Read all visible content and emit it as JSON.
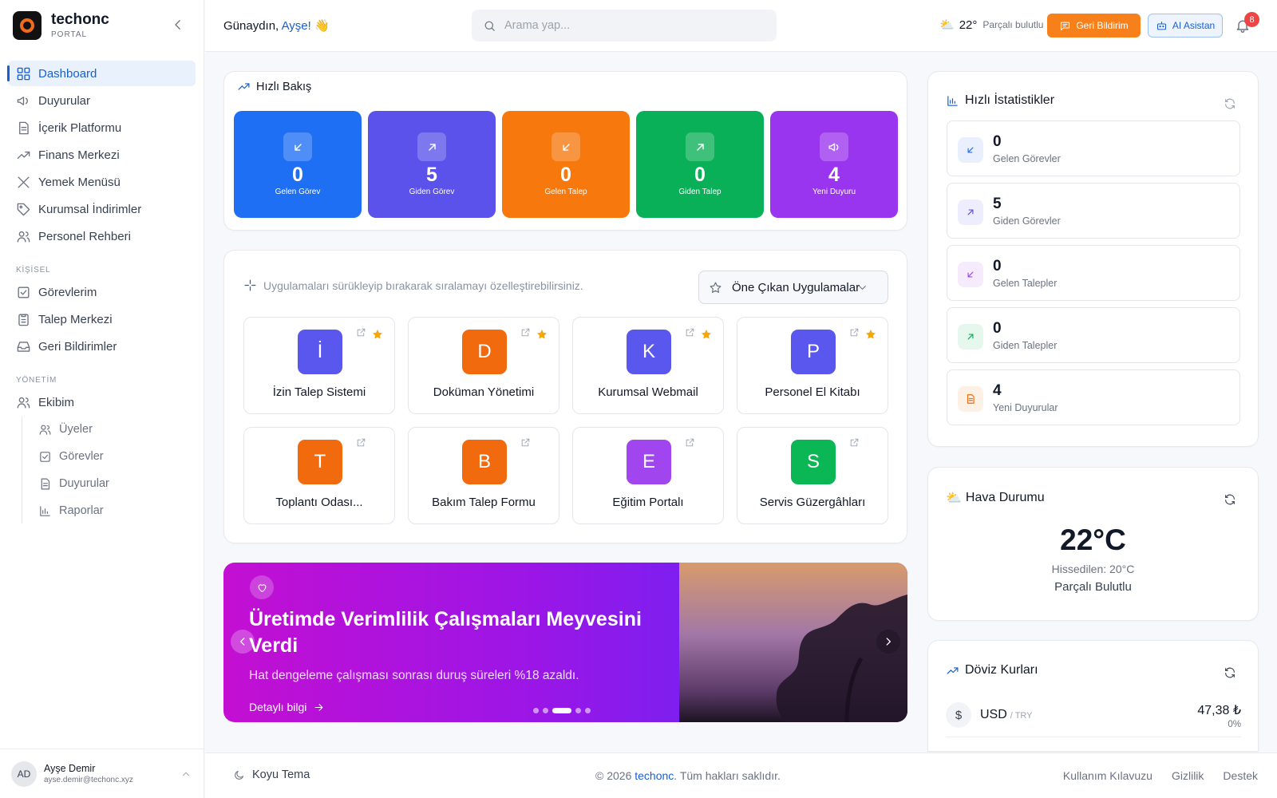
{
  "brand": {
    "name": "techonc",
    "sub": "PORTAL"
  },
  "sidebar": {
    "main": [
      {
        "label": "Dashboard",
        "icon": "grid-icon"
      },
      {
        "label": "Duyurular",
        "icon": "megaphone-icon"
      },
      {
        "label": "İçerik Platformu",
        "icon": "document-icon"
      },
      {
        "label": "Finans Merkezi",
        "icon": "trend-icon"
      },
      {
        "label": "Yemek Menüsü",
        "icon": "utensils-icon"
      },
      {
        "label": "Kurumsal İndirimler",
        "icon": "tag-icon"
      },
      {
        "label": "Personel Rehberi",
        "icon": "users-icon"
      }
    ],
    "section_personal": "KİŞİSEL",
    "personal": [
      {
        "label": "Görevlerim",
        "icon": "checkbox-icon"
      },
      {
        "label": "Talep Merkezi",
        "icon": "clipboard-icon"
      },
      {
        "label": "Geri Bildirimler",
        "icon": "inbox-icon"
      }
    ],
    "section_admin": "YÖNETİM",
    "team": {
      "label": "Ekibim",
      "icon": "users-icon"
    },
    "team_sub": [
      {
        "label": "Üyeler",
        "icon": "users-icon"
      },
      {
        "label": "Görevler",
        "icon": "checkbox-icon"
      },
      {
        "label": "Duyurular",
        "icon": "document-icon"
      },
      {
        "label": "Raporlar",
        "icon": "bar-chart-icon"
      }
    ]
  },
  "user": {
    "initials": "AD",
    "name": "Ayşe Demir",
    "email": "ayse.demir@techonc.xyz"
  },
  "header": {
    "greeting": "Günaydın,",
    "name": "Ayşe!",
    "search_placeholder": "Arama yap...",
    "temp": "22°",
    "weather": "Parçalı bulutlu",
    "feedback": "Geri Bildirim",
    "ai": "AI Asistan",
    "notif_count": "8"
  },
  "quick": {
    "title": "Hızlı Bakış",
    "tiles": [
      {
        "value": "0",
        "label": "Gelen Görev",
        "color": "#1f6ff5",
        "icon": "arrow-down-left-icon"
      },
      {
        "value": "5",
        "label": "Giden Görev",
        "color": "#5a52ea",
        "icon": "arrow-up-right-icon"
      },
      {
        "value": "0",
        "label": "Gelen Talep",
        "color": "#f7780d",
        "icon": "arrow-down-left-icon"
      },
      {
        "value": "0",
        "label": "Giden Talep",
        "color": "#09b058",
        "icon": "arrow-up-right-icon"
      },
      {
        "value": "4",
        "label": "Yeni Duyuru",
        "color": "#9a35ef",
        "icon": "megaphone-icon"
      }
    ]
  },
  "apps": {
    "hint": "Uygulamaları sürükleyip bırakarak sıralamayı özelleştirebilirsiniz.",
    "select": "Öne Çıkan Uygulamalar",
    "items": [
      {
        "mono": "İ",
        "name": "İzin Talep Sistemi",
        "color": "#5a57ef",
        "starred": true
      },
      {
        "mono": "D",
        "name": "Doküman Yönetimi",
        "color": "#f26a0e",
        "starred": true
      },
      {
        "mono": "K",
        "name": "Kurumsal Webmail",
        "color": "#5a57ef",
        "starred": true
      },
      {
        "mono": "P",
        "name": "Personel El Kitabı",
        "color": "#5a57ef",
        "starred": true
      },
      {
        "mono": "T",
        "name": "Toplantı Odası...",
        "color": "#f26a0e",
        "starred": false
      },
      {
        "mono": "B",
        "name": "Bakım Talep Formu",
        "color": "#f26a0e",
        "starred": false
      },
      {
        "mono": "E",
        "name": "Eğitim Portalı",
        "color": "#a145ee",
        "starred": false
      },
      {
        "mono": "S",
        "name": "Servis Güzergâhları",
        "color": "#0bb654",
        "starred": false
      }
    ]
  },
  "banner": {
    "title": "Üretimde Verimlilik Çalışmaları Meyvesini Verdi",
    "subtitle": "Hat dengeleme çalışması sonrası duruş süreleri %18 azaldı.",
    "more": "Detaylı bilgi",
    "active_slide": 3,
    "slide_count": 5
  },
  "stats": {
    "title": "Hızlı İstatistikler",
    "items": [
      {
        "value": "0",
        "label": "Gelen Görevler",
        "bg": "#e9effd",
        "fg": "#1f6ff5",
        "icon": "arrow-down-left-icon"
      },
      {
        "value": "5",
        "label": "Giden Görevler",
        "bg": "#eeedfd",
        "fg": "#5a52ea",
        "icon": "arrow-up-right-icon"
      },
      {
        "value": "0",
        "label": "Gelen Talepler",
        "bg": "#f6eafd",
        "fg": "#a145ee",
        "icon": "arrow-down-left-icon"
      },
      {
        "value": "0",
        "label": "Giden Talepler",
        "bg": "#e6f8ee",
        "fg": "#09b058",
        "icon": "arrow-up-right-icon"
      },
      {
        "value": "4",
        "label": "Yeni Duyurular",
        "bg": "#fdf0e4",
        "fg": "#f26a0e",
        "icon": "document-icon"
      }
    ]
  },
  "weather": {
    "title": "Hava Durumu",
    "temp": "22°C",
    "feels": "Hissedilen: 20°C",
    "desc": "Parçalı Bulutlu"
  },
  "fx": {
    "title": "Döviz Kurları",
    "rows": [
      {
        "symbol": "$",
        "code": "USD",
        "pair": "/ TRY",
        "value": "47,38 ₺",
        "change": "0%"
      }
    ]
  },
  "footer": {
    "theme": "Koyu Tema",
    "copy_pre": "© 2026",
    "brand": "techonc",
    "copy_post": ". Tüm hakları saklıdır.",
    "links": [
      "Kullanım Kılavuzu",
      "Gizlilik",
      "Destek"
    ]
  }
}
